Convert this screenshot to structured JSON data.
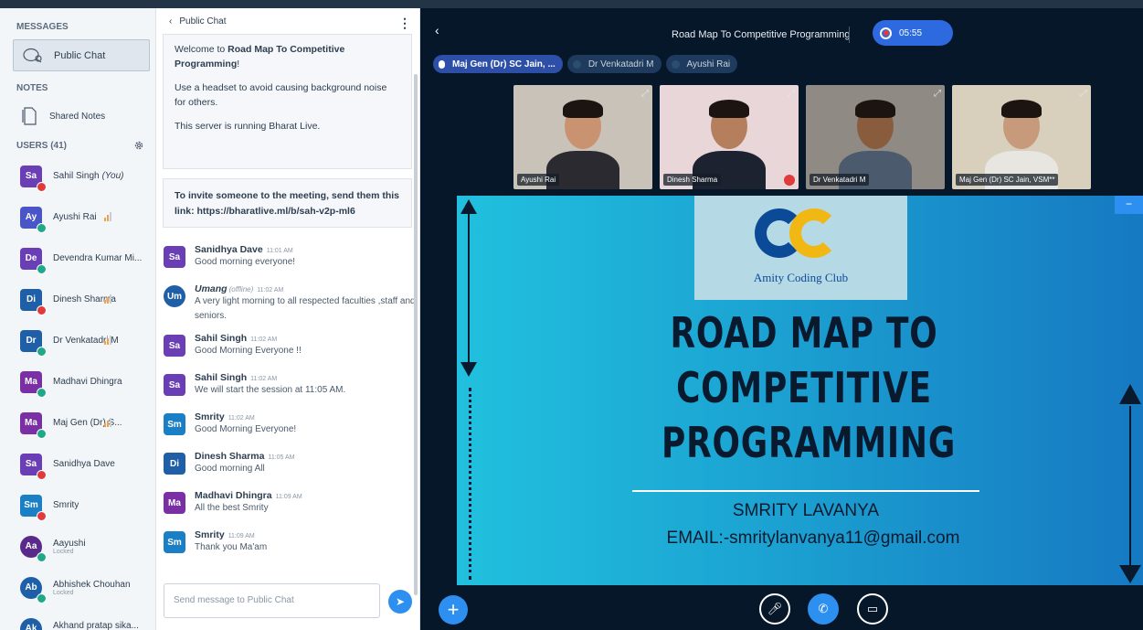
{
  "sidebar": {
    "messages_label": "MESSAGES",
    "public_chat_label": "Public Chat",
    "notes_label": "NOTES",
    "shared_notes_label": "Shared Notes",
    "users_label": "USERS (41)",
    "users": [
      {
        "initials": "Sa",
        "name": "Sahil Singh",
        "you": "(You)",
        "color": "#6a3fb5",
        "status": "mic-off",
        "signal": false
      },
      {
        "initials": "Ay",
        "name": "Ayushi Rai",
        "color": "#4a55c7",
        "status": "listen",
        "signal": true
      },
      {
        "initials": "De",
        "name": "Devendra Kumar Mi...",
        "color": "#6a3fb5",
        "status": "listen",
        "signal": false
      },
      {
        "initials": "Di",
        "name": "Dinesh Sharma",
        "color": "#1e5fa8",
        "status": "mic-off",
        "signal": true
      },
      {
        "initials": "Dr",
        "name": "Dr Venkatadri M",
        "color": "#1e5fa8",
        "status": "listen",
        "signal": true
      },
      {
        "initials": "Ma",
        "name": "Madhavi Dhingra",
        "color": "#7a2fa5",
        "status": "listen",
        "signal": false
      },
      {
        "initials": "Ma",
        "name": "Maj Gen (Dr) S...",
        "color": "#7a2fa5",
        "status": "listen",
        "signal": true
      },
      {
        "initials": "Sa",
        "name": "Sanidhya Dave",
        "color": "#6a3fb5",
        "status": "mic-off",
        "signal": false
      },
      {
        "initials": "Sm",
        "name": "Smrity",
        "color": "#1a7fc4",
        "status": "mic-off",
        "signal": false
      },
      {
        "initials": "Aa",
        "name": "Aayushi",
        "sub": "Locked",
        "color": "#5a2a8a",
        "status": "listen",
        "signal": false
      },
      {
        "initials": "Ab",
        "name": "Abhishek Chouhan",
        "sub": "Locked",
        "color": "#1e5fa8",
        "status": "listen",
        "signal": false
      },
      {
        "initials": "Ak",
        "name": "Akhand pratap sika...",
        "sub": "Locked",
        "color": "#1e5fa8",
        "status": "listen",
        "signal": false
      }
    ]
  },
  "chat": {
    "header": "Public Chat",
    "welcome_prefix": "Welcome to ",
    "welcome_bold": "Road Map To Competitive Programming",
    "welcome_suffix": "!",
    "welcome_line2": "Use a headset to avoid causing background noise for others.",
    "welcome_line3": "This server is running Bharat Live.",
    "invite": "To invite someone to the meeting, send them this link: https://bharatlive.ml/b/sah-v2p-ml6",
    "messages": [
      {
        "initials": "Sa",
        "color": "#6a3fb5",
        "round": false,
        "name": "Sanidhya Dave",
        "offline": "",
        "time": "11:01 AM",
        "text": "Good morning everyone!"
      },
      {
        "initials": "Um",
        "color": "#1e5fa8",
        "round": true,
        "name": "Umang",
        "offline": "(offline)",
        "time": "11:02 AM",
        "text": "A very light morning to all respected faculties ,staff and seniors."
      },
      {
        "initials": "Sa",
        "color": "#6a3fb5",
        "round": false,
        "name": "Sahil Singh",
        "offline": "",
        "time": "11:02 AM",
        "text": "Good Morning Everyone !!"
      },
      {
        "initials": "Sa",
        "color": "#6a3fb5",
        "round": false,
        "name": "Sahil Singh",
        "offline": "",
        "time": "11:02 AM",
        "text": "We will start the session at 11:05 AM."
      },
      {
        "initials": "Sm",
        "color": "#1a7fc4",
        "round": false,
        "name": "Smrity",
        "offline": "",
        "time": "11:02 AM",
        "text": "Good Morning Everyone!"
      },
      {
        "initials": "Di",
        "color": "#1e5fa8",
        "round": false,
        "name": "Dinesh Sharma",
        "offline": "",
        "time": "11:05 AM",
        "text": "Good morning All"
      },
      {
        "initials": "Ma",
        "color": "#7a2fa5",
        "round": false,
        "name": "Madhavi Dhingra",
        "offline": "",
        "time": "11:09 AM",
        "text": "All the best Smrity"
      },
      {
        "initials": "Sm",
        "color": "#1a7fc4",
        "round": false,
        "name": "Smrity",
        "offline": "",
        "time": "11:09 AM",
        "text": "Thank you Ma'am"
      }
    ],
    "composer_placeholder": "Send message to Public Chat"
  },
  "meeting": {
    "title": "Road Map To Competitive Programming",
    "timer": "05:55",
    "talkers": [
      {
        "name": "Maj Gen (Dr) SC Jain, ...",
        "active": true
      },
      {
        "name": "Dr Venkatadri M",
        "active": false
      },
      {
        "name": "Ayushi Rai",
        "active": false
      }
    ],
    "videos": [
      {
        "name": "Ayushi Rai",
        "bg": "#c9c2b8",
        "skin": "#c99372",
        "shirt": "#2a2a30",
        "mic_off": false
      },
      {
        "name": "Dinesh Sharma",
        "bg": "#e8d6d8",
        "skin": "#b57e5c",
        "shirt": "#1d2230",
        "mic_off": true
      },
      {
        "name": "Dr Venkatadri M",
        "bg": "#8f8a84",
        "skin": "#8a5c3e",
        "shirt": "#4c5a6e",
        "mic_off": false
      },
      {
        "name": "Maj Gen (Dr) SC Jain, VSM**",
        "bg": "#d9cfbd",
        "skin": "#c69a7a",
        "shirt": "#e8e6e0",
        "mic_off": false
      }
    ]
  },
  "slide": {
    "logo_caption": "Amity Coding Club",
    "title_lines": [
      "ROAD MAP TO",
      "COMPETITIVE",
      "PROGRAMMING"
    ],
    "author": "SMRITY LAVANYA",
    "email": "EMAIL:-smritylanvanya11@gmail.com"
  },
  "colors": {
    "accent": "#2d8ff0",
    "record": "#e03a3a",
    "main_bg": "#06172a"
  }
}
